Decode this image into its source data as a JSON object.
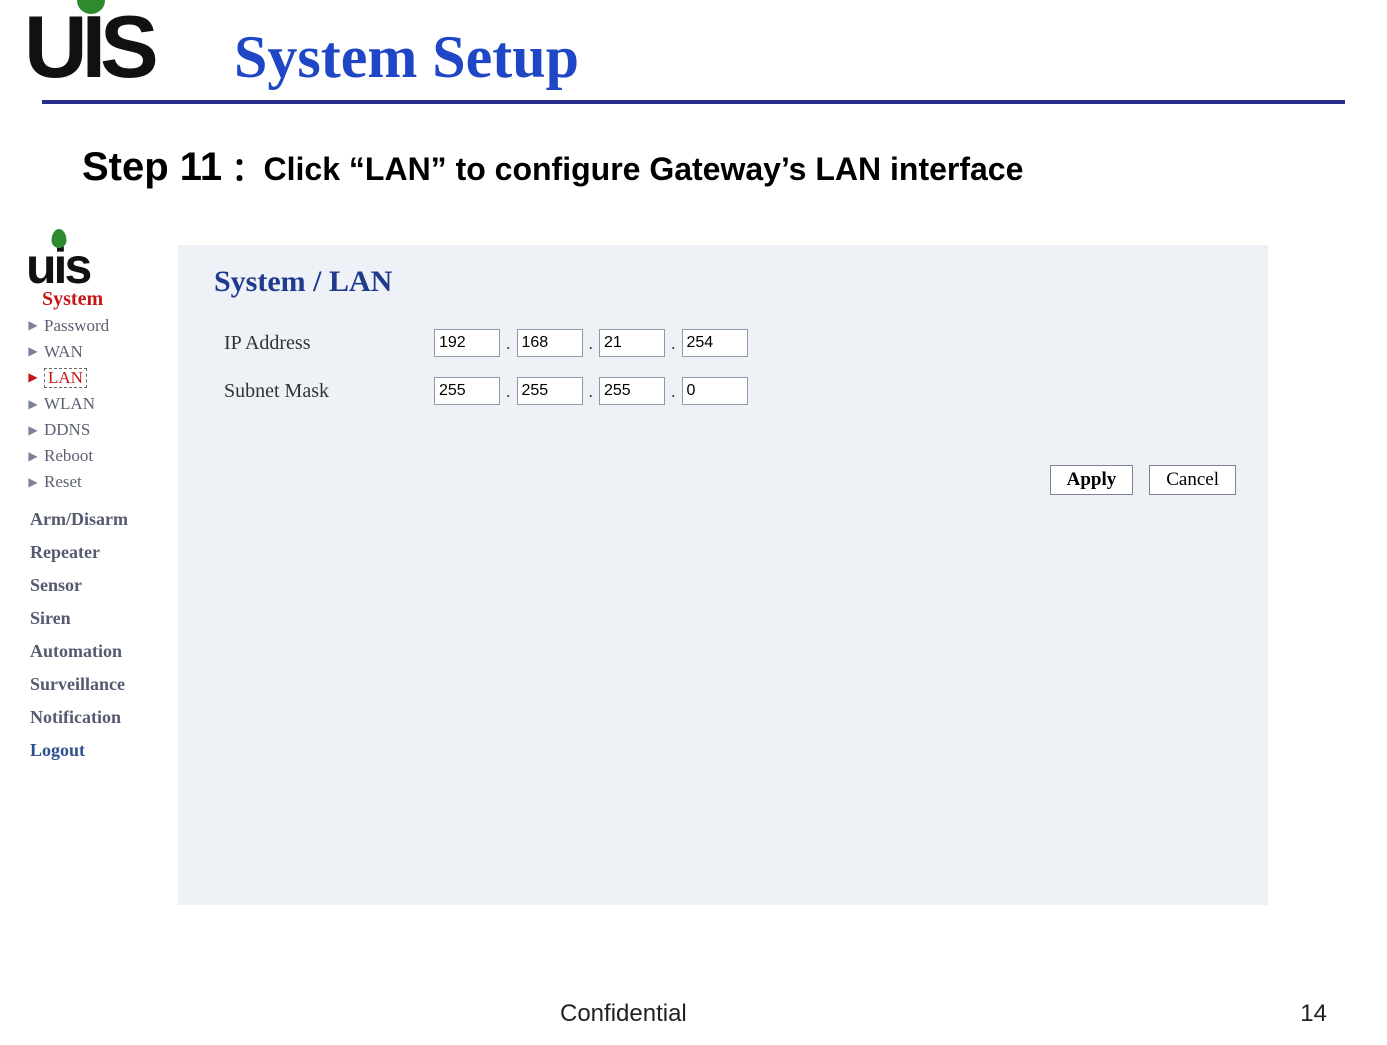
{
  "slide": {
    "title": "System Setup",
    "step_label": "Step 11",
    "step_desc": "：Click “LAN” to configure Gateway’s LAN interface"
  },
  "sidebar": {
    "section_system": "System",
    "items": [
      {
        "label": "Password",
        "selected": false
      },
      {
        "label": "WAN",
        "selected": false
      },
      {
        "label": "LAN",
        "selected": true
      },
      {
        "label": "WLAN",
        "selected": false
      },
      {
        "label": "DDNS",
        "selected": false
      },
      {
        "label": "Reboot",
        "selected": false
      },
      {
        "label": "Reset",
        "selected": false
      }
    ],
    "sections": [
      "Arm/Disarm",
      "Repeater",
      "Sensor",
      "Siren",
      "Automation",
      "Surveillance",
      "Notification",
      "Logout"
    ]
  },
  "panel": {
    "title": "System / LAN",
    "ip_label": "IP Address",
    "mask_label": "Subnet Mask",
    "ip": [
      "192",
      "168",
      "21",
      "254"
    ],
    "mask": [
      "255",
      "255",
      "255",
      "0"
    ],
    "apply_label": "Apply",
    "cancel_label": "Cancel"
  },
  "footer": {
    "confidential": "Confidential",
    "page": "14"
  },
  "logo_text": {
    "u": "U",
    "i": "I",
    "s": "S",
    "u_sm": "u",
    "i_sm": "i",
    "s_sm": "s"
  }
}
